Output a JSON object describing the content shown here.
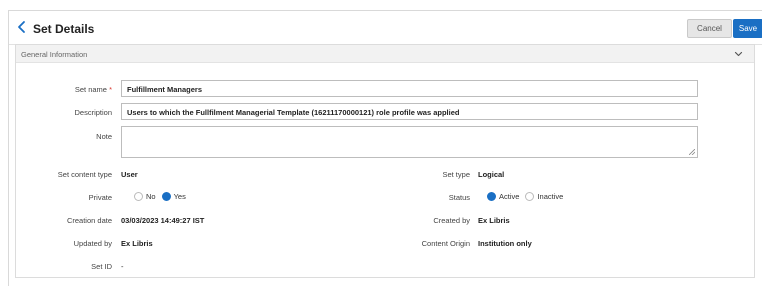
{
  "header": {
    "title": "Set Details",
    "cancel_label": "Cancel",
    "save_label": "Save"
  },
  "section": {
    "title": "General Information"
  },
  "fields": {
    "set_name": {
      "label": "Set name",
      "required_mark": "*",
      "value": "Fulfillment Managers"
    },
    "description": {
      "label": "Description",
      "value": "Users to which the Fullfilment Managerial Template (16211170000121) role profile was applied"
    },
    "note": {
      "label": "Note",
      "value": ""
    },
    "set_content_type": {
      "label": "Set content type",
      "value": "User"
    },
    "set_type": {
      "label": "Set type",
      "value": "Logical"
    },
    "private": {
      "label": "Private",
      "options": [
        "No",
        "Yes"
      ],
      "selected": "Yes"
    },
    "status": {
      "label": "Status",
      "options": [
        "Active",
        "Inactive"
      ],
      "selected": "Active"
    },
    "creation_date": {
      "label": "Creation date",
      "value": "03/03/2023 14:49:27 IST"
    },
    "created_by": {
      "label": "Created by",
      "value": "Ex Libris"
    },
    "updated_by": {
      "label": "Updated by",
      "value": "Ex Libris"
    },
    "content_origin": {
      "label": "Content Origin",
      "value": "Institution only"
    },
    "set_id": {
      "label": "Set ID",
      "value": "-"
    }
  },
  "colors": {
    "accent": "#1a6fc4",
    "required": "#d9342b",
    "section_bg": "#f2f2f2"
  },
  "icons": {
    "back": "chevron-left-icon",
    "collapse": "chevron-down-icon",
    "resize": "resize-handle-icon"
  }
}
